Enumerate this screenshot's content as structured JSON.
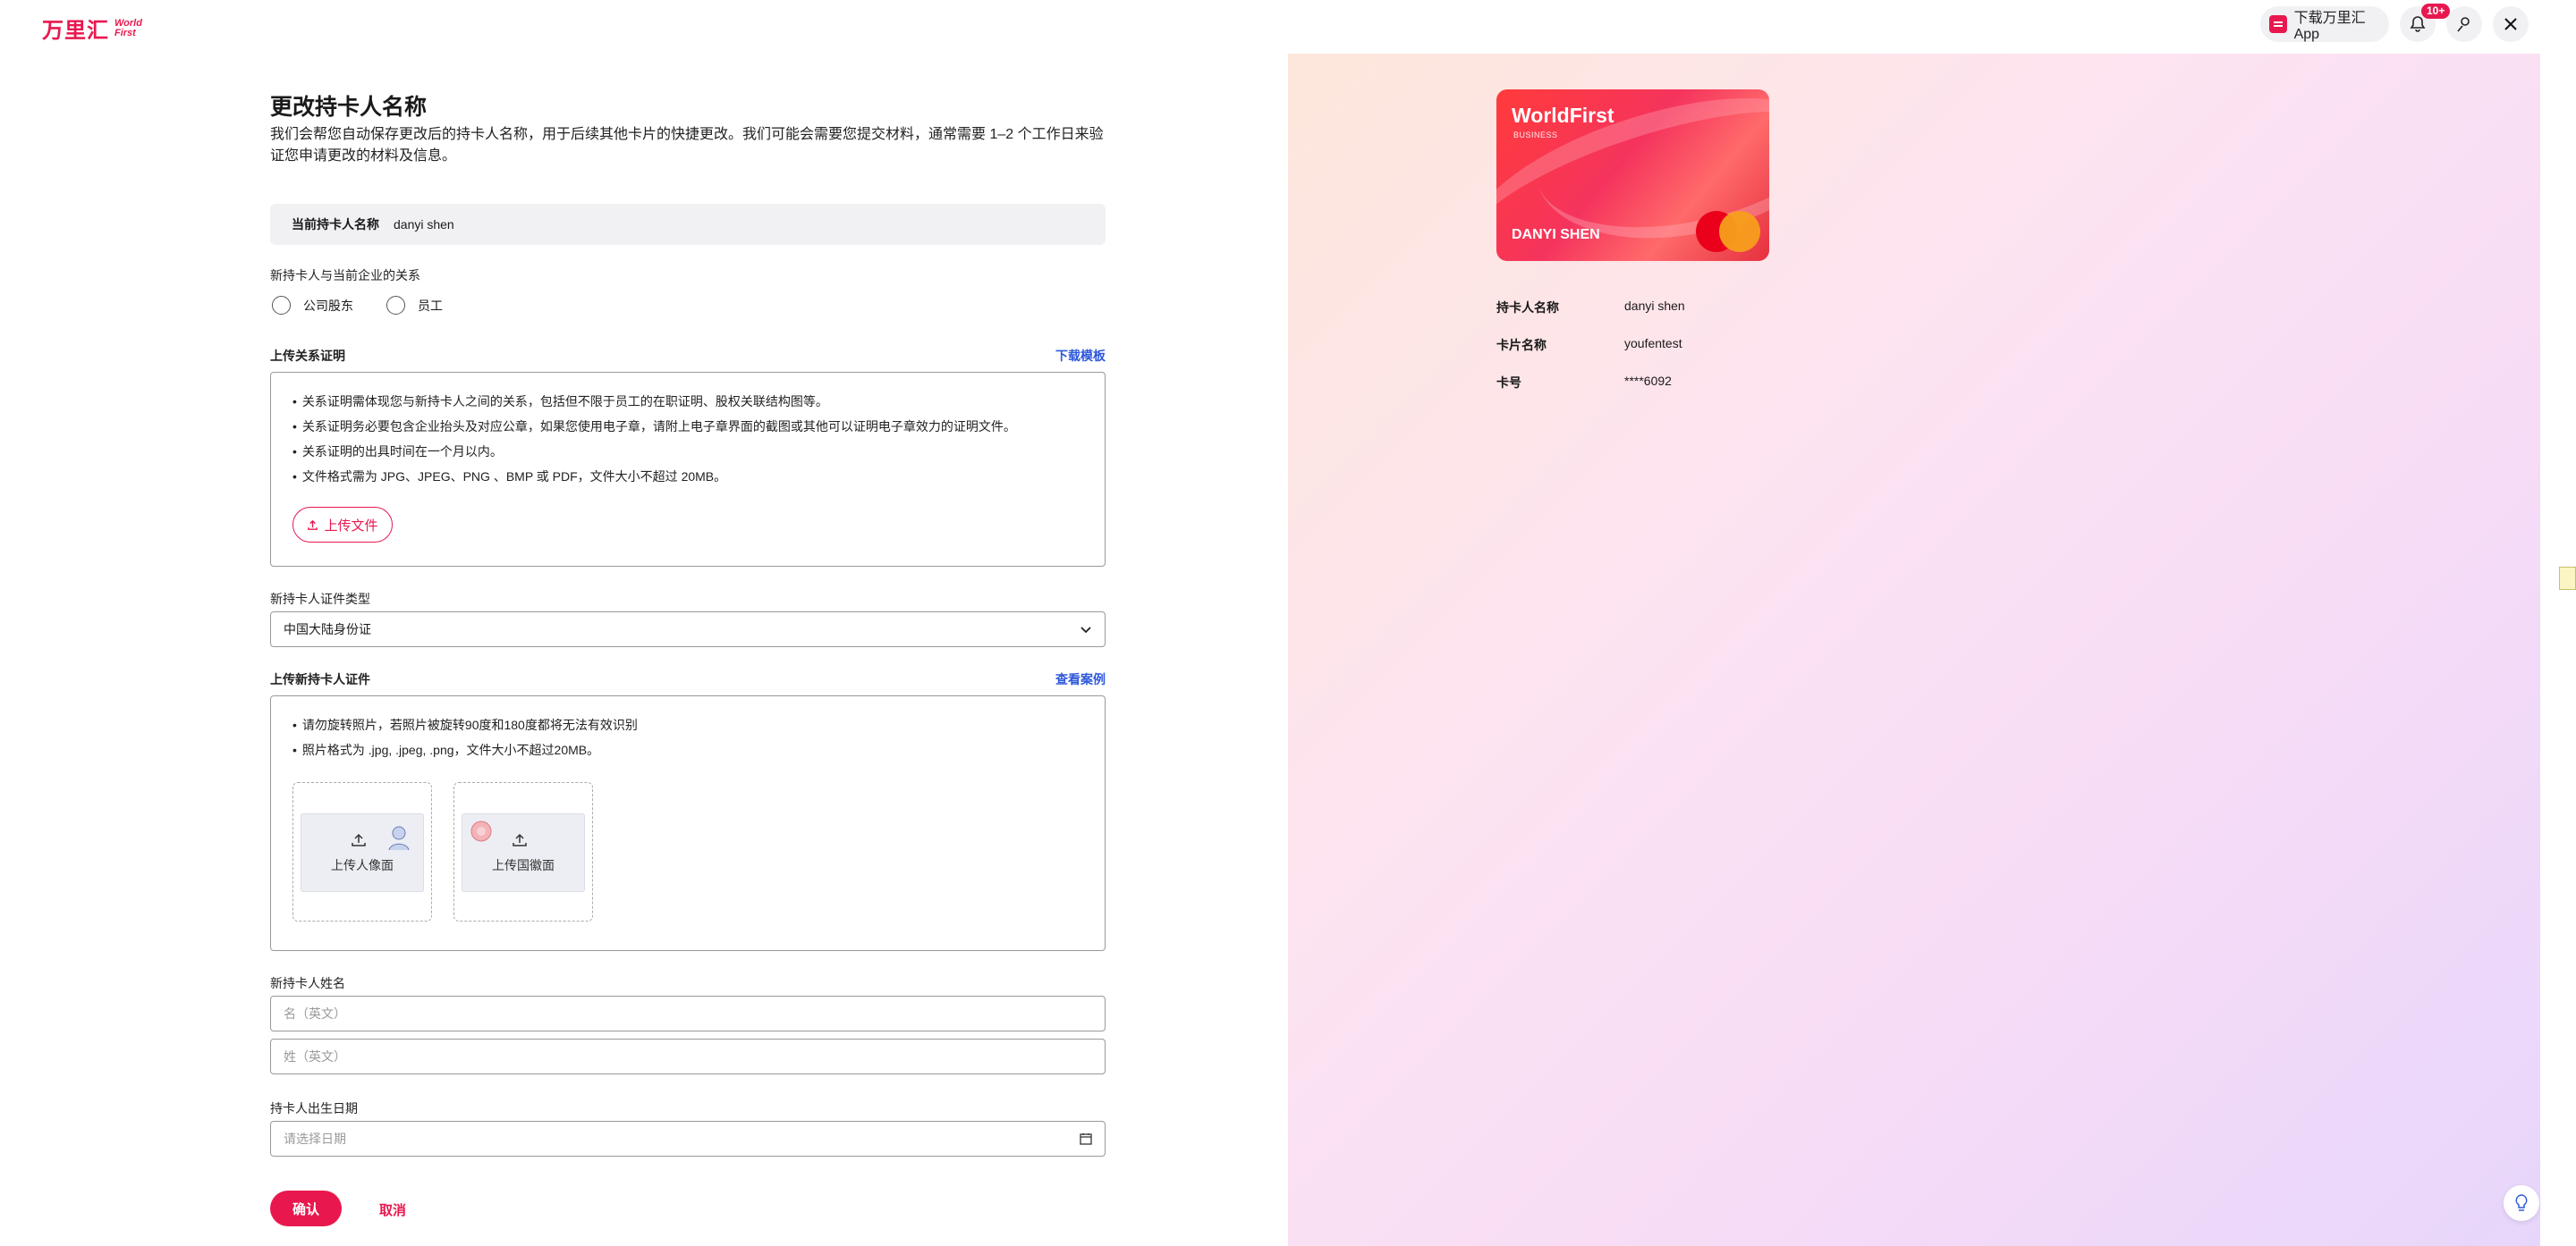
{
  "header": {
    "logo_cn": "万里汇",
    "logo_en_1": "World",
    "logo_en_2": "First",
    "app_download": "下载万里汇App",
    "notification_badge": "10+"
  },
  "form": {
    "title": "更改持卡人名称",
    "description": "我们会帮您自动保存更改后的持卡人名称，用于后续其他卡片的快捷更改。我们可能会需要您提交材料，通常需要 1–2 个工作日来验证您申请更改的材料及信息。",
    "current_label": "当前持卡人名称",
    "current_value": "danyi shen",
    "relation_label": "新持卡人与当前企业的关系",
    "relation_options": [
      "公司股东",
      "员工"
    ],
    "proof_label": "上传关系证明",
    "proof_link": "下载模板",
    "proof_notes": [
      "关系证明需体现您与新持卡人之间的关系，包括但不限于员工的在职证明、股权关联结构图等。",
      "关系证明务必要包含企业抬头及对应公章，如果您使用电子章，请附上电子章界面的截图或其他可以证明电子章效力的证明文件。",
      "关系证明的出具时间在一个月以内。",
      "文件格式需为 JPG、JPEG、PNG 、BMP 或 PDF，文件大小不超过 20MB。"
    ],
    "upload_file": "上传文件",
    "id_type_label": "新持卡人证件类型",
    "id_type_value": "中国大陆身份证",
    "id_upload_label": "上传新持卡人证件",
    "id_example_link": "查看案例",
    "id_notes": [
      "请勿旋转照片，若照片被旋转90度和180度都将无法有效识别",
      "照片格式为 .jpg, .jpeg, .png，文件大小不超过20MB。"
    ],
    "id_front": "上传人像面",
    "id_back": "上传国徽面",
    "name_label": "新持卡人姓名",
    "first_name_placeholder": "名（英文）",
    "last_name_placeholder": "姓（英文）",
    "dob_label": "持卡人出生日期",
    "dob_placeholder": "请选择日期",
    "confirm": "确认",
    "cancel": "取消"
  },
  "card": {
    "brand": "WorldFirst",
    "tier": "BUSINESS",
    "holder": "DANYI SHEN",
    "details": [
      {
        "key": "持卡人名称",
        "value": "danyi shen"
      },
      {
        "key": "卡片名称",
        "value": "youfentest"
      },
      {
        "key": "卡号",
        "value": "****6092"
      }
    ]
  },
  "colors": {
    "accent": "#e8184f",
    "link": "#2e58d9"
  }
}
